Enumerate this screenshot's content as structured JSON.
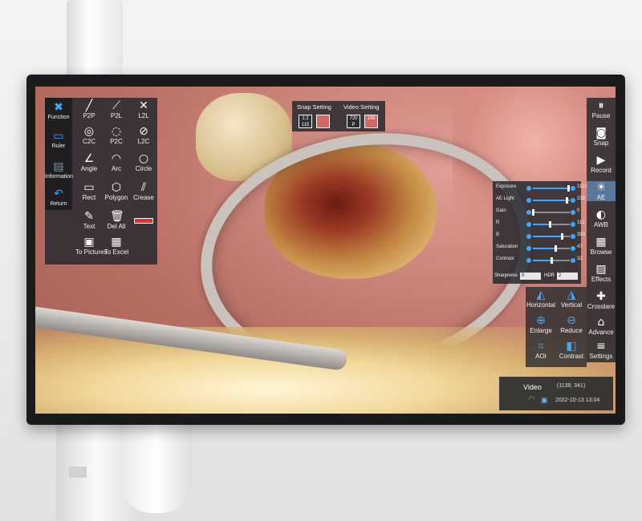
{
  "left_panel": {
    "side_items": [
      {
        "label": "Function",
        "icon": "function-x-icon"
      },
      {
        "label": "Ruler",
        "icon": "ruler-icon"
      },
      {
        "label": "Information",
        "icon": "information-icon"
      },
      {
        "label": "Return",
        "icon": "return-arrow-icon"
      }
    ],
    "tools": [
      {
        "label": "P2P",
        "icon": "p2p-line-icon"
      },
      {
        "label": "P2L",
        "icon": "p2l-icon"
      },
      {
        "label": "L2L",
        "icon": "l2l-icon"
      },
      {
        "label": "C2C",
        "icon": "c2c-icon"
      },
      {
        "label": "P2C",
        "icon": "p2c-icon"
      },
      {
        "label": "L2C",
        "icon": "l2c-icon"
      },
      {
        "label": "Angle",
        "icon": "angle-icon"
      },
      {
        "label": "Arc",
        "icon": "arc-icon"
      },
      {
        "label": "Circle",
        "icon": "circle-icon"
      },
      {
        "label": "Rect",
        "icon": "rect-icon"
      },
      {
        "label": "Polygon",
        "icon": "polygon-icon"
      },
      {
        "label": "Crease",
        "icon": "crease-icon"
      },
      {
        "label": "Text",
        "icon": "text-icon"
      },
      {
        "label": "Del All",
        "icon": "delete-all-icon"
      },
      {
        "label": "",
        "icon": "color-swatch-icon",
        "color": "#e23131"
      },
      {
        "label": "To Pictures",
        "icon": "to-pictures-icon"
      },
      {
        "label": "To Excel",
        "icon": "to-excel-icon"
      }
    ]
  },
  "top_settings": {
    "snap_label": "Snap Setting",
    "video_label": "Video Setting",
    "snap_buttons": [
      "1:2\n115",
      ""
    ],
    "video_buttons": [
      "720\nP",
      "108"
    ]
  },
  "adjust_panel": {
    "sliders": [
      {
        "label": "Exposure",
        "value": "1123",
        "level": 0.95
      },
      {
        "label": "AE Light",
        "value": "239",
        "level": 0.92
      },
      {
        "label": "Gain",
        "value": "0",
        "level": 0.0
      },
      {
        "label": "R",
        "value": "112",
        "level": 0.45
      },
      {
        "label": "B",
        "value": "390",
        "level": 0.78
      },
      {
        "label": "Saturation",
        "value": "47",
        "level": 0.6
      },
      {
        "label": "Contrast",
        "value": "32",
        "level": 0.5
      }
    ],
    "sharpness_label": "Sharpness",
    "sharpness_value": "0",
    "hdr_label": "HDR",
    "hdr_value": "2"
  },
  "right_column": [
    {
      "label": "Pause",
      "icon": "pause-icon"
    },
    {
      "label": "Snap",
      "icon": "camera-icon"
    },
    {
      "label": "Record",
      "icon": "video-record-icon"
    },
    {
      "label": "AE",
      "icon": "ae-icon",
      "active": true
    },
    {
      "label": "AWB",
      "icon": "awb-icon"
    },
    {
      "label": "Browse",
      "icon": "browse-icon"
    },
    {
      "label": "Effects",
      "icon": "effects-icon"
    },
    {
      "label": "Crosslare",
      "icon": "crosshair-icon"
    },
    {
      "label": "Advance",
      "icon": "advance-home-icon"
    },
    {
      "label": "Settings",
      "icon": "settings-icon"
    }
  ],
  "control_grid": [
    {
      "label": "Horizontal",
      "icon": "flip-horizontal-icon"
    },
    {
      "label": "Vertical",
      "icon": "flip-vertical-icon"
    },
    {
      "label": "Enlarge",
      "icon": "zoom-in-icon"
    },
    {
      "label": "Reduce",
      "icon": "zoom-out-icon"
    },
    {
      "label": "AOI",
      "icon": "aoi-crop-icon"
    },
    {
      "label": "Contrast",
      "icon": "contrast-icon"
    }
  ],
  "status": {
    "mode": "Video",
    "coords": "(1139, 341)",
    "timestamp": "2022-10-13 13:04",
    "wifi_color": "#2ed04a"
  },
  "colors": {
    "accent": "#3ea7ff",
    "record_red": "#e23131"
  }
}
